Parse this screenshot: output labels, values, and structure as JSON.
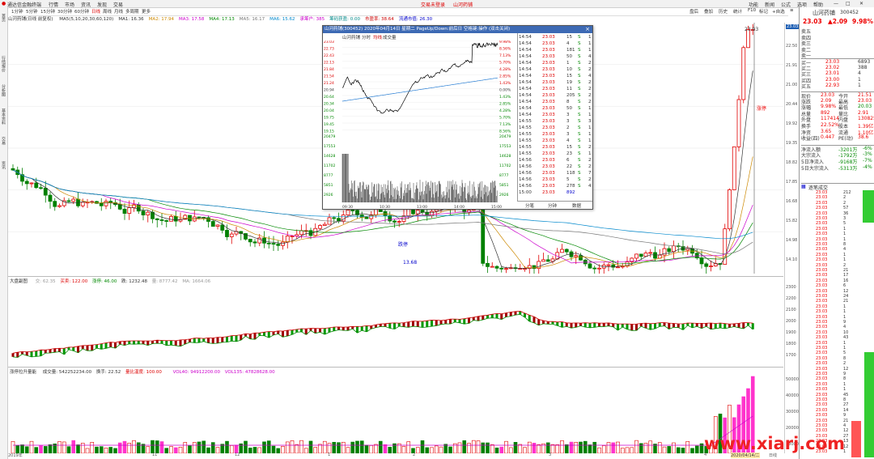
{
  "topbar": {
    "app_title": "通达信金融终端",
    "menus": [
      "行情",
      "市场",
      "资讯",
      "发现",
      "交易"
    ],
    "center": [
      "交易未登录",
      "山河药铺"
    ],
    "right": [
      "功能",
      "新闻",
      "公式",
      "选项",
      "帮助"
    ]
  },
  "toolbar": {
    "periods": [
      "1分钟",
      "5分钟",
      "15分钟",
      "30分钟",
      "60分钟",
      "日线",
      "周线",
      "月线",
      "多周期",
      "更多"
    ],
    "right_buttons": [
      "盘后",
      "叠加",
      "历史",
      "统计",
      "F10",
      "标记",
      "+自选",
      "≡"
    ]
  },
  "stock": {
    "name": "山河药铺",
    "code": "300452",
    "price": "23.03",
    "change": "▲2.09",
    "change_pct": "9.98%"
  },
  "legend": {
    "main_title": "山河药铺(日线 前复权)",
    "ma_items": [
      {
        "text": "MA5(5,10,20,30,60,120)",
        "color": "#333333"
      },
      {
        "text": "MA1: 16.36",
        "color": "#333333"
      },
      {
        "text": "MA2: 17.94",
        "color": "#cc8800"
      },
      {
        "text": "MA3: 17.58",
        "color": "#cc00cc"
      },
      {
        "text": "MA4: 17.13",
        "color": "#008800"
      },
      {
        "text": "MA5: 16.17",
        "color": "#777777"
      },
      {
        "text": "MA6: 15.62",
        "color": "#0088cc"
      },
      {
        "text": "承筹户: 385",
        "color": "#cc00cc"
      },
      {
        "text": "筹码获盈: 0.00",
        "color": "#008888"
      },
      {
        "text": "市盈率: 38.64",
        "color": "#cc0000"
      },
      {
        "text": "流通市值: 26.30",
        "color": "#0000cc"
      }
    ]
  },
  "ind_panel": {
    "title": "大盘副图",
    "items": [
      "交: 62.35",
      "买卖: 122.00",
      "涨停: 46.00",
      "跌: 1232.48",
      "量: 8777.42",
      "MA: 1664.06"
    ]
  },
  "vol_panel": {
    "title": "涨停拉升量能",
    "items": [
      "成交量: 542252234.00",
      "换手: 22.52",
      "量比温度: 100.00",
      "VOL40: 94912200.00",
      "VOL135: 47828628.00"
    ]
  },
  "price_axis": [
    "23.03",
    "22.50",
    "21.91",
    "21.00",
    "20.44",
    "19.92",
    "19.35",
    "18.82",
    "17.85",
    "16.68",
    "15.82",
    "14.98",
    "14.10"
  ],
  "ind_axis": [
    "2300",
    "2200",
    "2100",
    "2000",
    "1900",
    "1800",
    "1700"
  ],
  "vol_axis": [
    "50000",
    "40000",
    "30000",
    "20000",
    "10000"
  ],
  "x_axis": [
    "2019年",
    "11",
    "12",
    "1",
    "2",
    "3",
    "4",
    "2020/04/14/二",
    "日线"
  ],
  "annotations": {
    "limit_down": "跌停",
    "limit_up": "涨停",
    "low": "13.68",
    "high": "23.03"
  },
  "popup": {
    "title": "山河药铺(300452) 2020年04月14日 星期二 PageUp/Down:前后日 空格键:操作 (双击关闭)",
    "tabs": [
      "山河药铺",
      "分时",
      "均线",
      "成交量"
    ],
    "left_labels": [
      "23.03",
      "22.73",
      "22.43",
      "22.13",
      "21.84",
      "21.54",
      "21.24",
      "20.94",
      "20.64",
      "20.34",
      "20.04",
      "19.75",
      "19.45",
      "19.15",
      "20479",
      "17553",
      "14628",
      "11702",
      "8777",
      "5851",
      "2926"
    ],
    "right_labels": [
      "9.98%",
      "8.56%",
      "7.13%",
      "5.70%",
      "4.28%",
      "2.85%",
      "1.43%",
      "0.00%",
      "1.43%",
      "2.85%",
      "4.28%",
      "5.70%",
      "7.13%",
      "8.56%",
      "20479",
      "17553",
      "14628",
      "11702",
      "8777",
      "5851",
      "2926"
    ],
    "times": [
      "09:30",
      "10:30",
      "13:00",
      "14:00",
      "15:00"
    ],
    "ticks": [
      [
        "14:54",
        "23.03",
        "15",
        "S",
        "1"
      ],
      [
        "14:54",
        "23.03",
        "4",
        "S",
        "1"
      ],
      [
        "14:54",
        "23.03",
        "181",
        "S",
        "1"
      ],
      [
        "14:54",
        "23.03",
        "50",
        "S",
        "4"
      ],
      [
        "14:54",
        "23.03",
        "1",
        "S",
        "2"
      ],
      [
        "14:54",
        "23.03",
        "10",
        "S",
        "2"
      ],
      [
        "14:54",
        "23.03",
        "15",
        "S",
        "4"
      ],
      [
        "14:54",
        "23.03",
        "19",
        "S",
        "2"
      ],
      [
        "14:54",
        "23.03",
        "11",
        "S",
        "2"
      ],
      [
        "14:54",
        "23.03",
        "205",
        "S",
        "2"
      ],
      [
        "14:54",
        "23.03",
        "8",
        "S",
        "2"
      ],
      [
        "14:54",
        "23.03",
        "50",
        "S",
        "1"
      ],
      [
        "14:54",
        "23.03",
        "3",
        "S",
        "1"
      ],
      [
        "14:55",
        "23.03",
        "3",
        "S",
        "3"
      ],
      [
        "14:55",
        "23.03",
        "2",
        "S",
        "1"
      ],
      [
        "14:55",
        "23.03",
        "3",
        "S",
        "1"
      ],
      [
        "14:55",
        "23.03",
        "4",
        "S",
        "1"
      ],
      [
        "14:55",
        "23.03",
        "15",
        "S",
        "2"
      ],
      [
        "14:55",
        "23.03",
        "23",
        "S",
        "1"
      ],
      [
        "14:56",
        "23.03",
        "6",
        "S",
        "2"
      ],
      [
        "14:56",
        "23.03",
        "22",
        "S",
        "2"
      ],
      [
        "14:56",
        "23.03",
        "118",
        "S",
        "7"
      ],
      [
        "14:56",
        "23.03",
        "5",
        "S",
        "2"
      ],
      [
        "14:56",
        "23.03",
        "278",
        "S",
        "4"
      ],
      [
        "15:00",
        "23.03",
        "892",
        "",
        ""
      ]
    ],
    "bottom": [
      "分笔",
      "分钟",
      "数据"
    ]
  },
  "right_panel": {
    "order_book": [
      {
        "label": "卖五",
        "price": "",
        "vol": ""
      },
      {
        "label": "卖四",
        "price": "",
        "vol": ""
      },
      {
        "label": "卖三",
        "price": "",
        "vol": ""
      },
      {
        "label": "卖二",
        "price": "",
        "vol": ""
      },
      {
        "label": "卖一",
        "price": "",
        "vol": ""
      },
      {
        "label": "买一",
        "price": "23.03",
        "vol": "6893"
      },
      {
        "label": "买二",
        "price": "23.02",
        "vol": "388"
      },
      {
        "label": "买三",
        "price": "23.01",
        "vol": "4"
      },
      {
        "label": "买四",
        "price": "23.00",
        "vol": "1"
      },
      {
        "label": "买五",
        "price": "22.93",
        "vol": "1"
      }
    ],
    "stats": [
      [
        "现价",
        "23.03",
        "今开",
        "21.51"
      ],
      [
        "涨跌",
        "2.09",
        "最高",
        "23.03"
      ],
      [
        "涨幅",
        "9.98%",
        "最低",
        "20.03"
      ],
      [
        "总量",
        "892",
        "量比",
        "2.91"
      ],
      [
        "外盘",
        "117414",
        "内盘",
        "130825"
      ],
      [
        "换手",
        "22.52%",
        "股本",
        "1.39亿"
      ],
      [
        "净资",
        "3.65",
        "流通",
        "1.10亿"
      ],
      [
        "收益(四)",
        "0.447",
        "PE(动)",
        "38.6"
      ]
    ],
    "flows": [
      [
        "净流入额",
        "-3201万",
        "-6%"
      ],
      [
        "大宗流入",
        "-1792万",
        "-3%"
      ],
      [
        "5日净流入",
        "-9168万",
        "-7%"
      ],
      [
        "5日大宗流入",
        "-5313万",
        "-4%"
      ]
    ],
    "section_title": "逐笔成交",
    "rows": [
      "23.03",
      "23.03",
      "23.03",
      "23.03",
      "23.03",
      "23.03",
      "23.03",
      "23.03",
      "23.03",
      "23.03",
      "23.03",
      "23.03",
      "23.03",
      "23.03",
      "23.03",
      "23.03",
      "23.03",
      "23.03",
      "23.03",
      "23.03",
      "23.03",
      "23.03",
      "23.03",
      "23.03",
      "23.03",
      "23.03",
      "23.03",
      "23.03",
      "23.03",
      "23.03",
      "23.03",
      "23.03",
      "23.03",
      "23.03",
      "23.03",
      "23.03",
      "23.03",
      "23.03",
      "23.03",
      "23.03",
      "23.03",
      "23.03",
      "23.03",
      "23.03",
      "23.03",
      "23.03",
      "23.03",
      "23.03",
      "23.03",
      "23.03",
      "23.03"
    ],
    "row_vols": [
      "212",
      "2",
      "2",
      "57",
      "36",
      "3",
      "5",
      "1",
      "1",
      "1",
      "8",
      "4",
      "1",
      "1",
      "2",
      "21",
      "17",
      "16",
      "6",
      "12",
      "24",
      "21",
      "1",
      "1",
      "1",
      "9",
      "4",
      "10",
      "43",
      "1",
      "1",
      "5",
      "8",
      "2",
      "12",
      "9",
      "8",
      "1",
      "1",
      "45",
      "8",
      "27",
      "14",
      "9",
      "21",
      "4",
      "12",
      "27",
      "13",
      "12",
      "1"
    ]
  },
  "watermark": "www.xiarj.com",
  "colors": {
    "up": "#e00000",
    "down": "#008000",
    "bg": "#ffffff",
    "grid": "#eeeeee",
    "popup_title": "#3d6ab4"
  }
}
